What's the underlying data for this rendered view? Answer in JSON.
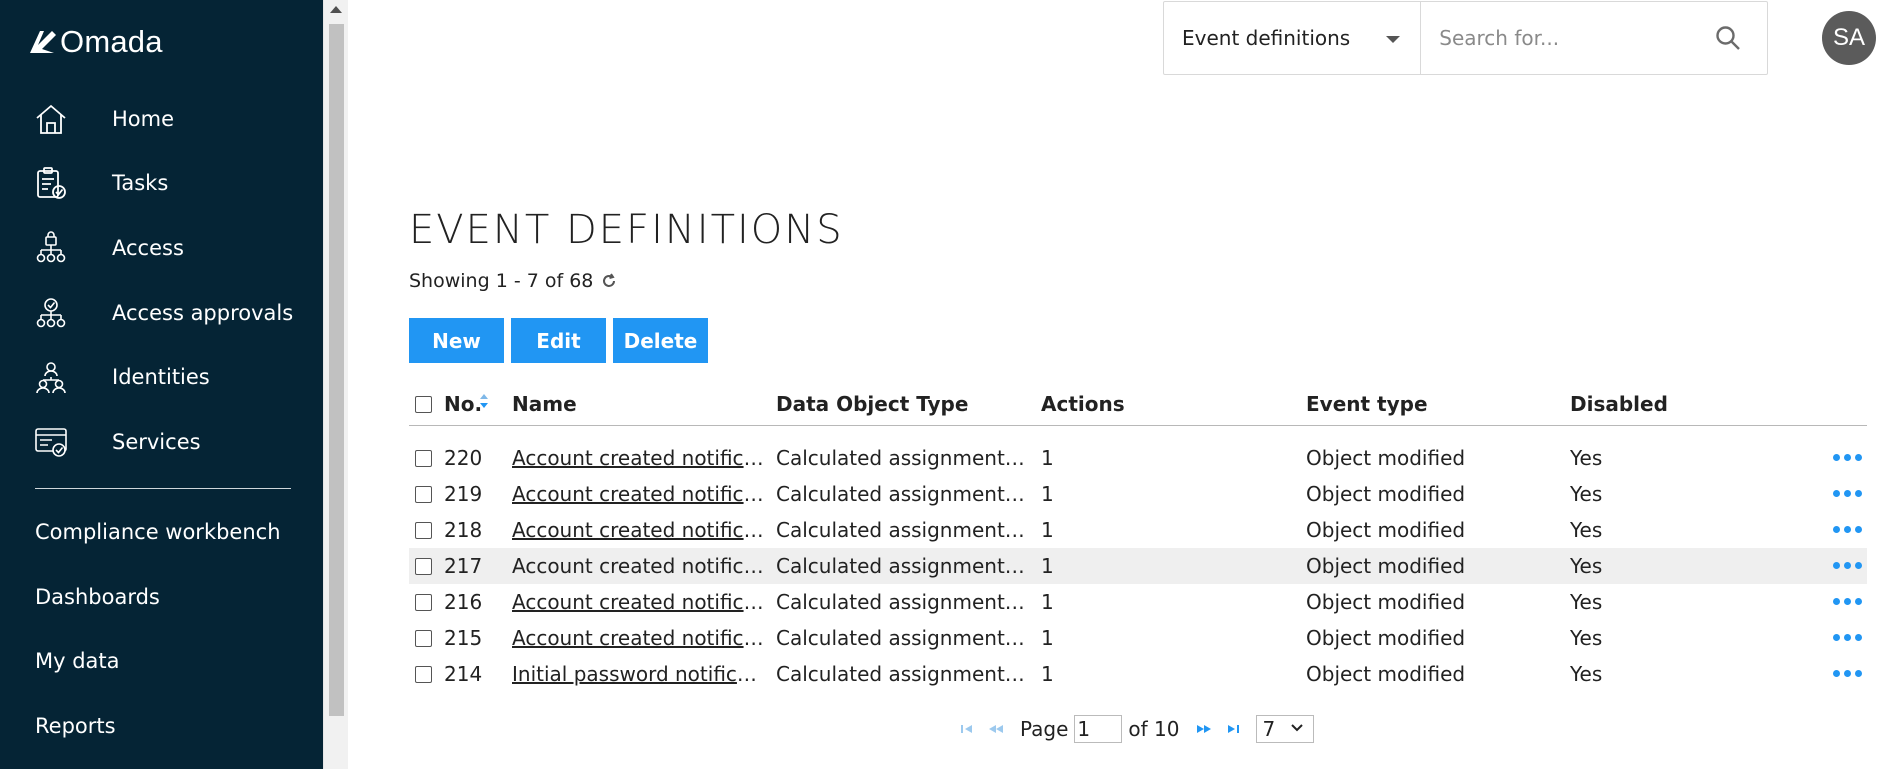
{
  "brand": {
    "name": "Omada"
  },
  "sidebar": {
    "items": [
      {
        "label": "Home",
        "icon": "home-icon"
      },
      {
        "label": "Tasks",
        "icon": "tasks-icon"
      },
      {
        "label": "Access",
        "icon": "access-icon"
      },
      {
        "label": "Access approvals",
        "icon": "access-approvals-icon"
      },
      {
        "label": "Identities",
        "icon": "identities-icon"
      },
      {
        "label": "Services",
        "icon": "services-icon"
      }
    ],
    "links": [
      {
        "label": "Compliance workbench"
      },
      {
        "label": "Dashboards"
      },
      {
        "label": "My data"
      },
      {
        "label": "Reports"
      }
    ]
  },
  "search": {
    "scope": "Event definitions",
    "placeholder": "Search for..."
  },
  "user": {
    "initials": "SA"
  },
  "page": {
    "title": "EVENT DEFINITIONS",
    "showing": "Showing 1 - 7 of 68"
  },
  "toolbar": {
    "new_label": "New",
    "edit_label": "Edit",
    "delete_label": "Delete"
  },
  "table": {
    "columns": {
      "no": "No.",
      "name": "Name",
      "data_object_type": "Data Object Type",
      "actions": "Actions",
      "event_type": "Event type",
      "disabled": "Disabled"
    },
    "rows": [
      {
        "no": "220",
        "name": "Account created notificat...",
        "data_object_type": "Calculated assignments f...",
        "actions": "1",
        "event_type": "Object modified",
        "disabled": "Yes"
      },
      {
        "no": "219",
        "name": "Account created notificat...",
        "data_object_type": "Calculated assignments f...",
        "actions": "1",
        "event_type": "Object modified",
        "disabled": "Yes"
      },
      {
        "no": "218",
        "name": "Account created notificat...",
        "data_object_type": "Calculated assignments f...",
        "actions": "1",
        "event_type": "Object modified",
        "disabled": "Yes"
      },
      {
        "no": "217",
        "name": "Account created notificat...",
        "data_object_type": "Calculated assignments f...",
        "actions": "1",
        "event_type": "Object modified",
        "disabled": "Yes"
      },
      {
        "no": "216",
        "name": "Account created notificat...",
        "data_object_type": "Calculated assignments f...",
        "actions": "1",
        "event_type": "Object modified",
        "disabled": "Yes"
      },
      {
        "no": "215",
        "name": "Account created notificat...",
        "data_object_type": "Calculated assignments f...",
        "actions": "1",
        "event_type": "Object modified",
        "disabled": "Yes"
      },
      {
        "no": "214",
        "name": "Initial password notificati...",
        "data_object_type": "Calculated assignments f...",
        "actions": "1",
        "event_type": "Object modified",
        "disabled": "Yes"
      }
    ]
  },
  "pager": {
    "page_label": "Page",
    "current_page": "1",
    "of_label": "of 10",
    "page_size": "7"
  },
  "colors": {
    "sidebar_bg": "#052435",
    "accent": "#2196f3",
    "highlight_row": "#efefef"
  }
}
